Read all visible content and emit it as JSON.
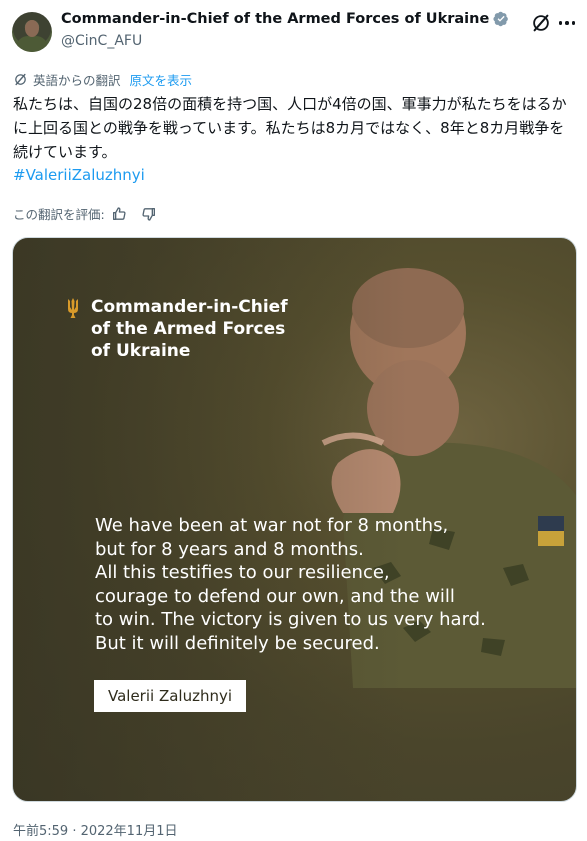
{
  "author": {
    "display_name": "Commander-in-Chief of the Armed Forces of Ukraine",
    "handle": "@CinC_AFU",
    "verified": true
  },
  "translation": {
    "source_label": "英語からの翻訳",
    "show_original_label": "原文を表示",
    "rate_label": "この翻訳を評価:"
  },
  "tweet": {
    "text": "私たちは、自国の28倍の面積を持つ国、人口が4倍の国、軍事力が私たちをはるかに上回る国との戦争を戦っています。私たちは8カ月ではなく、8年と8カ月戦争を続けています。",
    "hashtag": "#ValeriiZaluzhnyi",
    "timestamp": "午前5:59 · 2022年11月1日"
  },
  "media": {
    "brand_text": "Commander-in-Chief\nof the Armed Forces\nof Ukraine",
    "quote": "We have been at war not for 8 months,\nbut for 8 years and 8 months.\nAll this testifies to our resilience,\ncourage to defend our own, and the will\nto win. The victory is given to us very hard.\nBut it will definitely be secured.",
    "signature": "Valerii Zaluzhnyi"
  },
  "icons": {
    "verified": "verified-badge-icon",
    "grok": "grok-icon",
    "more": "more-icon",
    "translate": "translate-icon",
    "thumbs_up": "thumbs-up-icon",
    "thumbs_down": "thumbs-down-icon",
    "trident": "trident-icon"
  },
  "colors": {
    "link": "#1d9bf0",
    "secondary_text": "#536471",
    "verified_badge": "#829aab",
    "trident": "#d89a2a"
  }
}
